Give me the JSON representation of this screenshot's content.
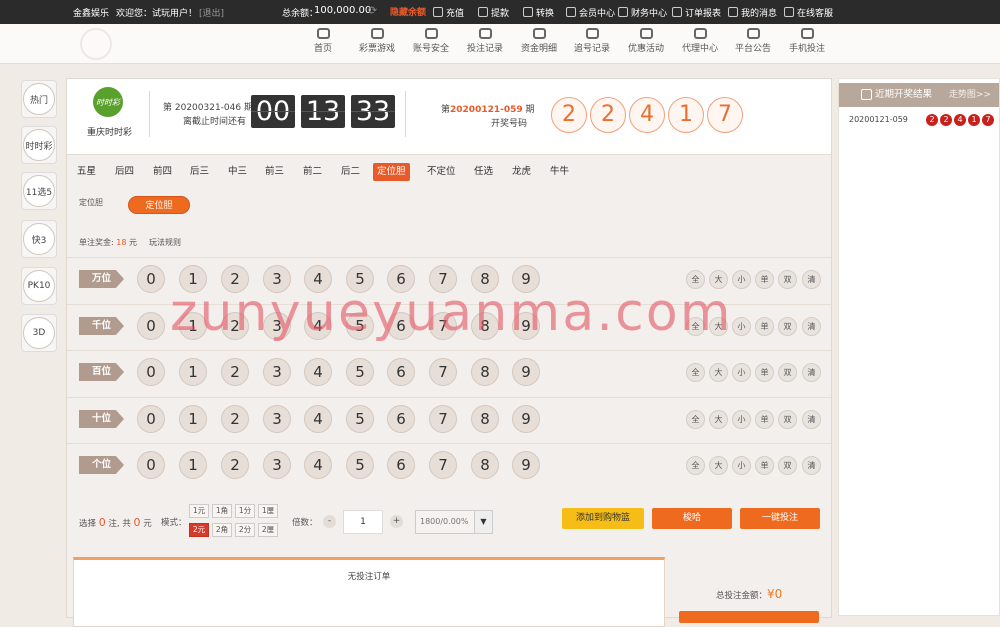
{
  "topbar": {
    "brand": "金鑫娱乐",
    "welcome": "欢迎您：试玩用户！",
    "logout": "[退出]",
    "balance_label": "总余额：",
    "balance_value": "100,000.00",
    "refresh_icon": "refresh-icon",
    "hide_balance": "隐藏余额",
    "links": [
      {
        "label": "充值",
        "icon": "deposit-icon"
      },
      {
        "label": "提款",
        "icon": "withdraw-icon"
      },
      {
        "label": "转换",
        "icon": "transfer-icon"
      },
      {
        "label": "会员中心",
        "icon": "user-icon"
      },
      {
        "label": "财务中心",
        "icon": "finance-icon"
      },
      {
        "label": "订单报表",
        "icon": "report-icon"
      },
      {
        "label": "我的消息",
        "icon": "mail-icon"
      },
      {
        "label": "在线客服",
        "icon": "service-icon"
      }
    ]
  },
  "nav": [
    {
      "label": "首页",
      "icon": "home-icon"
    },
    {
      "label": "彩票游戏",
      "icon": "lottery-icon"
    },
    {
      "label": "账号安全",
      "icon": "shield-icon"
    },
    {
      "label": "投注记录",
      "icon": "bet-record-icon"
    },
    {
      "label": "资金明细",
      "icon": "money-icon"
    },
    {
      "label": "追号记录",
      "icon": "chase-icon"
    },
    {
      "label": "优惠活动",
      "icon": "gift-icon"
    },
    {
      "label": "代理中心",
      "icon": "agent-icon"
    },
    {
      "label": "平台公告",
      "icon": "notice-icon"
    },
    {
      "label": "手机投注",
      "icon": "mobile-icon"
    }
  ],
  "sidebar": [
    "热门",
    "时时彩",
    "11选5",
    "快3",
    "PK10",
    "3D"
  ],
  "lottery": {
    "logo_text": "时时彩",
    "name": "重庆时时彩",
    "issue_line1": "第 20200321-046 期",
    "issue_line2": "离截止时间还有",
    "countdown": [
      "00",
      "13",
      "33"
    ],
    "draw_prefix": "第",
    "draw_issue": "20200121-059",
    "draw_suffix": "期",
    "draw_label": "开奖号码",
    "draw_numbers": [
      "2",
      "2",
      "4",
      "1",
      "7"
    ]
  },
  "tabs": {
    "items": [
      "五星",
      "后四",
      "前四",
      "后三",
      "中三",
      "前三",
      "前二",
      "后二",
      "定位胆",
      "不定位",
      "任选",
      "龙虎",
      "牛牛"
    ],
    "active": "定位胆"
  },
  "subtype_label": "定位胆",
  "subtype_pill": "定位胆",
  "prize": {
    "label": "单注奖金:",
    "amount": "18",
    "unit": "元"
  },
  "rules_label": "玩法规则",
  "positions": [
    "万位",
    "千位",
    "百位",
    "十位",
    "个位"
  ],
  "digits": [
    "0",
    "1",
    "2",
    "3",
    "4",
    "5",
    "6",
    "7",
    "8",
    "9"
  ],
  "quick": [
    "全",
    "大",
    "小",
    "单",
    "双",
    "清"
  ],
  "bottom": {
    "sel_prefix": "选择",
    "sel_count": "0",
    "sel_mid": "注, 共",
    "sel_amount": "0",
    "sel_suffix": "元",
    "mode_label": "模式：",
    "modes": [
      "1元",
      "1角",
      "1分",
      "1厘",
      "2元",
      "2角",
      "2分",
      "2厘"
    ],
    "mode_active": "2元",
    "mult_label": "倍数：",
    "minus": "-",
    "mult_value": "1",
    "plus": "+",
    "rebate": "1800/0.00%",
    "add_cart": "添加到购物篮",
    "random": "梭哈",
    "one_click": "一键投注"
  },
  "cart": {
    "empty_text": "无投注订单"
  },
  "total": {
    "label": "总投注金额：",
    "value": "¥0"
  },
  "right_panel": {
    "title": "近期开奖结果",
    "trend": "走势图>>",
    "issue": "20200121-059",
    "numbers": [
      "2",
      "2",
      "4",
      "1",
      "7"
    ]
  },
  "watermark": "zunyueyuanma.com",
  "colors": {
    "accent": "#e85a2a",
    "ball": "#c8211b",
    "btn_yellow": "#f6bd16",
    "btn_orange": "#ee6a1e"
  }
}
